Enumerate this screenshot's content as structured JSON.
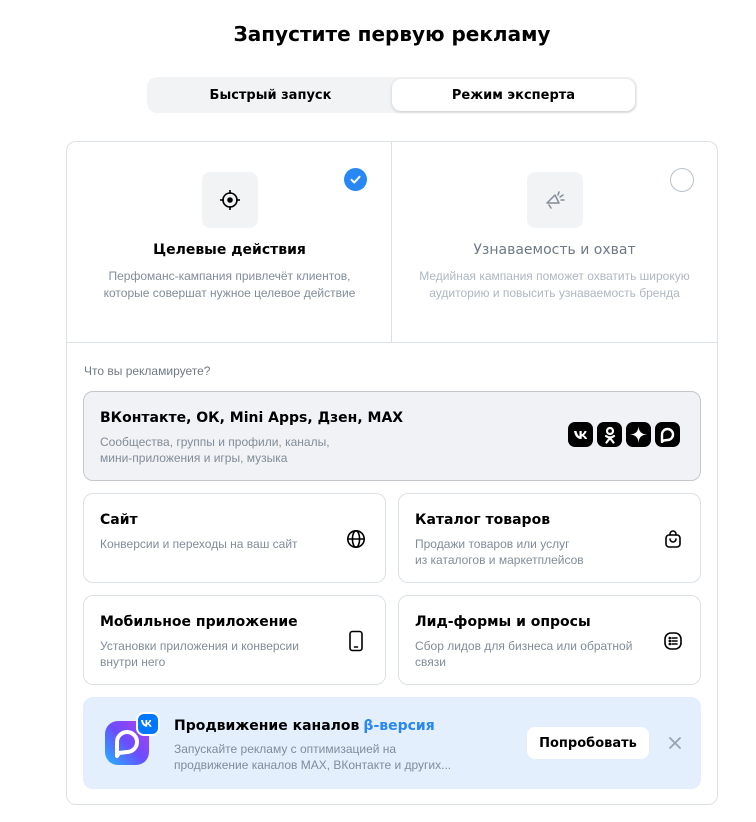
{
  "header": {
    "title": "Запустите первую рекламу"
  },
  "mode_switch": {
    "quick_label": "Быстрый запуск",
    "expert_label": "Режим эксперта",
    "selected": "expert"
  },
  "goals": [
    {
      "title": "Целевые действия",
      "description": "Перфоманс-кампания привлечёт клиентов, которые совершат нужное целевое действие",
      "icon": "target-icon",
      "selected": true
    },
    {
      "title": "Узнаваемость и охват",
      "description": "Медийная кампания поможет охватить широкую аудиторию и повысить узнаваемость бренда",
      "icon": "megaphone-icon",
      "selected": false
    }
  ],
  "question": "Что вы рекламируете?",
  "objects": {
    "social": {
      "title": "ВКонтакте, ОК, Mini Apps, Дзен, MAX",
      "description_line1": "Сообщества, группы и профили, каналы,",
      "description_line2": "мини-приложения и игры, музыка",
      "icons": [
        "vk-icon",
        "ok-icon",
        "dzen-icon",
        "max-icon"
      ]
    },
    "site": {
      "title": "Сайт",
      "description": "Конверсии и переходы на ваш сайт",
      "icon": "globe-icon"
    },
    "catalog": {
      "title": "Каталог товаров",
      "description_line1": "Продажи товаров или услуг",
      "description_line2": "из каталогов и маркетплейсов",
      "icon": "shopping-bag-icon"
    },
    "mobile": {
      "title": "Мобильное приложение",
      "description_line1": "Установки приложения и конверсии",
      "description_line2": "внутри него",
      "icon": "smartphone-icon"
    },
    "lead": {
      "title": "Лид-формы и опросы",
      "description_line1": "Сбор лидов для бизнеса или обратной",
      "description_line2": "связи",
      "icon": "form-list-icon"
    }
  },
  "promo": {
    "title": "Продвижение каналов",
    "badge": "β-версия",
    "description_line1": "Запускайте рекламу с оптимизацией на",
    "description_line2": "продвижение каналов MAX, ВКонтакте и других...",
    "button_label": "Попробовать",
    "colors": {
      "background": "#e3effd",
      "accent": "#2787f5"
    }
  }
}
